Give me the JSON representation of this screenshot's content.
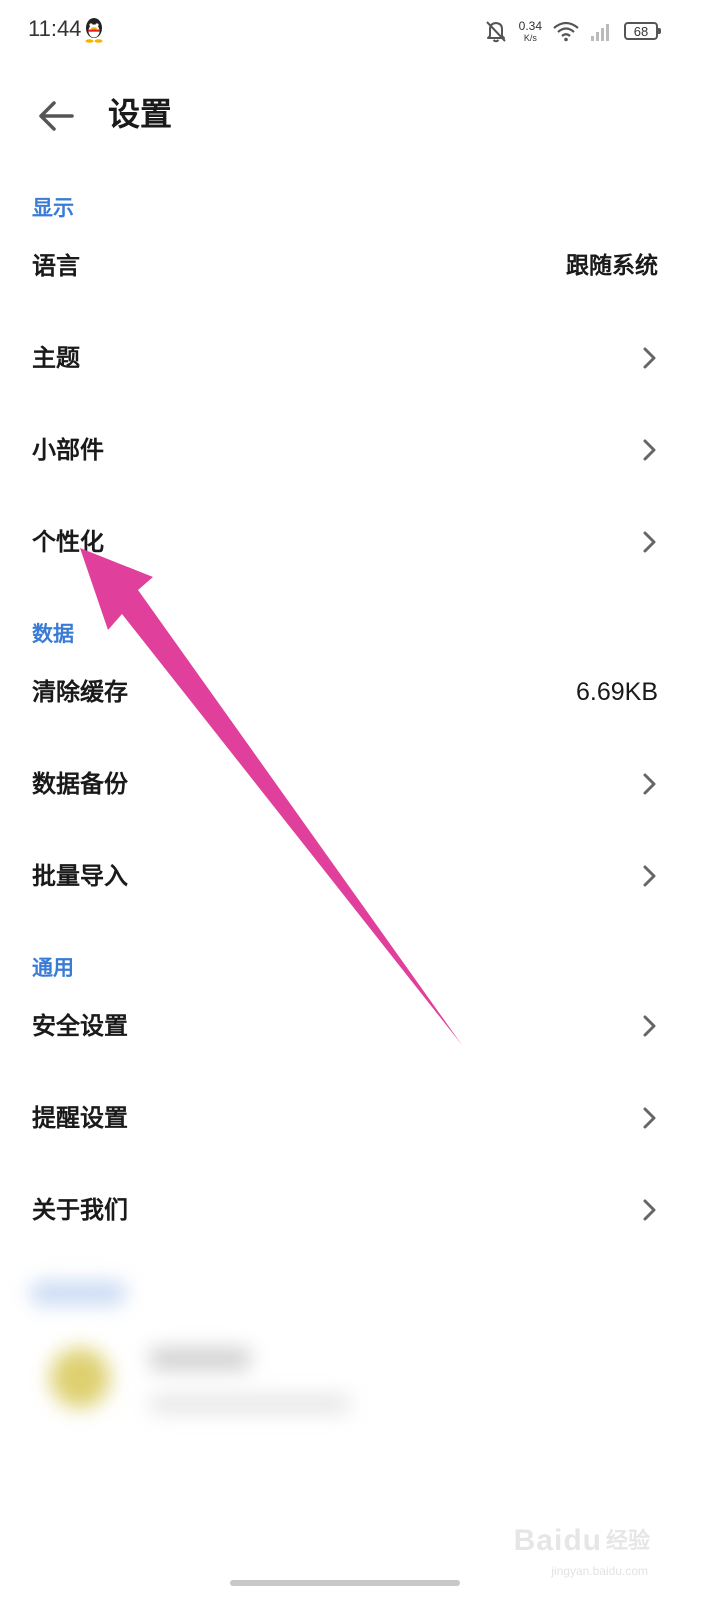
{
  "status_bar": {
    "time": "11:44",
    "net_speed_value": "0.34",
    "net_speed_unit": "K/s",
    "battery": "68",
    "icons": [
      "qq-icon",
      "bell-muted-icon",
      "wifi-icon",
      "signal-icon",
      "battery-icon"
    ]
  },
  "header": {
    "title": "设置",
    "back_icon": "arrow-left-icon"
  },
  "sections": {
    "display": {
      "title": "显示",
      "items": [
        {
          "label": "语言",
          "value": "跟随系统"
        },
        {
          "label": "主题"
        },
        {
          "label": "小部件"
        },
        {
          "label": "个性化"
        }
      ]
    },
    "data": {
      "title": "数据",
      "items": [
        {
          "label": "清除缓存",
          "value": "6.69KB"
        },
        {
          "label": "数据备份"
        },
        {
          "label": "批量导入"
        }
      ]
    },
    "general": {
      "title": "通用",
      "items": [
        {
          "label": "安全设置"
        },
        {
          "label": "提醒设置"
        },
        {
          "label": "关于我们"
        }
      ]
    }
  },
  "colors": {
    "section_header": "#3a7bd5",
    "annotation_arrow": "#e0409b",
    "text_primary": "#1a1a1a"
  },
  "watermark": {
    "brand": "Baidu",
    "tail": "经验",
    "url": "jingyan.baidu.com"
  }
}
